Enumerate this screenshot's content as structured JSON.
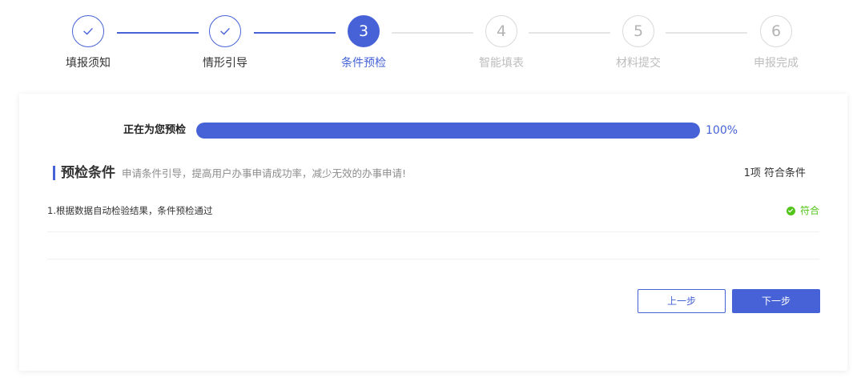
{
  "steps": [
    {
      "number": "1",
      "label": "填报须知",
      "status": "done"
    },
    {
      "number": "2",
      "label": "情形引导",
      "status": "done"
    },
    {
      "number": "3",
      "label": "条件预检",
      "status": "active"
    },
    {
      "number": "4",
      "label": "智能填表",
      "status": "pending"
    },
    {
      "number": "5",
      "label": "材料提交",
      "status": "pending"
    },
    {
      "number": "6",
      "label": "申报完成",
      "status": "pending"
    }
  ],
  "progress": {
    "label": "正在为您预检",
    "value": 100,
    "percent_text": "100%"
  },
  "section": {
    "title": "预检条件",
    "description": "申请条件引导，提高用户办事申请成功率，减少无效的办事申请!",
    "count_text": "1项 符合条件"
  },
  "items": [
    {
      "text": "1.根据数据自动检验结果，条件预检通过",
      "status_text": "符合",
      "status_icon": "check-circle-icon"
    }
  ],
  "buttons": {
    "prev_label": "上一步",
    "next_label": "下一步"
  },
  "colors": {
    "accent": "#4662d6",
    "success": "#52c41a",
    "inactive": "#bdbdbd"
  }
}
